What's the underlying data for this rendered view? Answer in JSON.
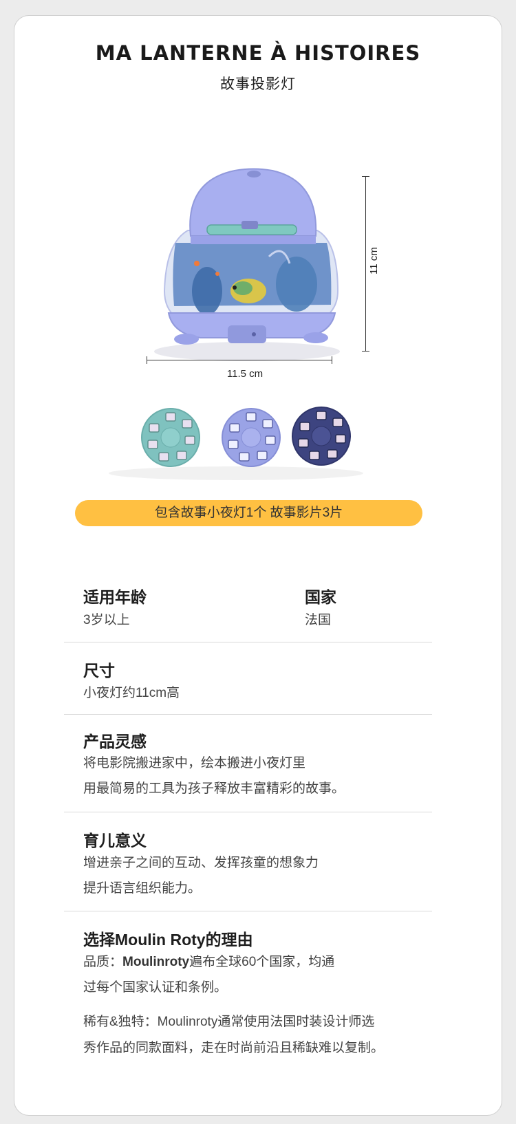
{
  "header": {
    "title": "MA LANTERNE À HISTOIRES",
    "subtitle": "故事投影灯"
  },
  "product_image": {
    "height_label": "11 cm",
    "width_label": "11.5 cm",
    "disc_colors": [
      "#7fc2bf",
      "#9aa3e6",
      "#3d4480"
    ],
    "lamp_color": "#a8aff0"
  },
  "package_note": "包含故事小夜灯1个 故事影片3片",
  "specs": {
    "age": {
      "label": "适用年龄",
      "value": "3岁以上"
    },
    "country": {
      "label": "国家",
      "value": "法国"
    },
    "size": {
      "label": "尺寸",
      "value": "小夜灯约11cm高"
    },
    "inspiration": {
      "label": "产品灵感",
      "lines": [
        "将电影院搬进家中，绘本搬进小夜灯里",
        "用最简易的工具为孩子释放丰富精彩的故事。"
      ]
    },
    "meaning": {
      "label": "育儿意义",
      "lines": [
        "增进亲子之间的互动、发挥孩童的想象力",
        "提升语言组织能力。"
      ]
    },
    "reasons": {
      "label": "选择Moulin Roty的理由",
      "quality_prefix": "品质：",
      "quality_brand": "Moulinroty",
      "quality_rest": "遍布全球60个国家，均通",
      "quality_line2": "过每个国家认证和条例。",
      "unique_line1": "稀有&独特：Moulinroty通常使用法国时装设计师选",
      "unique_line2": "秀作品的同款面料，走在时尚前沿且稀缺难以复制。"
    }
  },
  "colors": {
    "accent": "#ffc042",
    "background": "#ececec",
    "card": "#ffffff"
  }
}
